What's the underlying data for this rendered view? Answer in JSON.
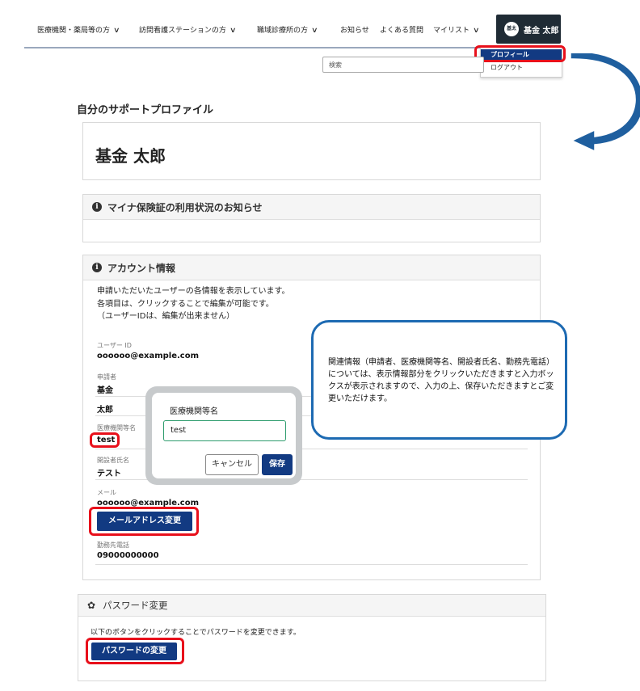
{
  "nav": {
    "items": [
      {
        "label": "医療機関・薬局等の方",
        "chevron": true
      },
      {
        "label": "訪問看護ステーションの方",
        "chevron": true
      },
      {
        "label": "職域診療所の方",
        "chevron": true
      },
      {
        "label": "お知らせ",
        "chevron": false
      },
      {
        "label": "よくある質問",
        "chevron": false
      },
      {
        "label": "マイリスト",
        "chevron": true
      }
    ],
    "user": {
      "avatar_text": "基太",
      "name": "基金 太郎"
    },
    "dropdown": {
      "profile_label": "プロフィール",
      "logout_label": "ログアウト"
    }
  },
  "search": {
    "placeholder": "検索"
  },
  "page": {
    "title": "自分のサポートプロファイル",
    "display_name": "基金 太郎"
  },
  "notice_card": {
    "title": "マイナ保険証の利用状況のお知らせ"
  },
  "account_card": {
    "title": "アカウント情報",
    "description": [
      "申請いただいたユーザーの各情報を表示しています。",
      "各項目は、クリックすることで編集が可能です。",
      "（ユーザーIDは、編集が出来ません）"
    ],
    "user_id_label": "ユーザー ID",
    "user_id_value": "oooooo@example.com",
    "applicant_label": "申請者",
    "applicant_last": "基金",
    "applicant_first": "太郎",
    "institution_label": "医療機関等名",
    "institution_value": "test",
    "founder_label": "開設者氏名",
    "founder_value": "テスト",
    "mail_label": "メール",
    "mail_value": "oooooo@example.com",
    "change_mail_button": "メールアドレス変更",
    "phone_label": "勤務先電話",
    "phone_value": "09000000000"
  },
  "edit_popup": {
    "label": "医療機関等名",
    "input_value": "test",
    "cancel": "キャンセル",
    "save": "保存"
  },
  "callout": {
    "text": "関連情報（申請者、医療機関等名、開設者氏名、勤務先電話）については、表示情報部分をクリックいただきますと入力ボックスが表示されますので、入力の上、保存いただきますとご変更いただけます。"
  },
  "password_card": {
    "title": "パスワード変更",
    "description": "以下のボタンをクリックすることでパスワードを変更できます。",
    "button": "パスワードの変更"
  },
  "colors": {
    "navy": "#123a82",
    "highlight_red": "#e8101b",
    "callout_border": "#1d6ab2",
    "arrow": "#1f5f9f"
  }
}
